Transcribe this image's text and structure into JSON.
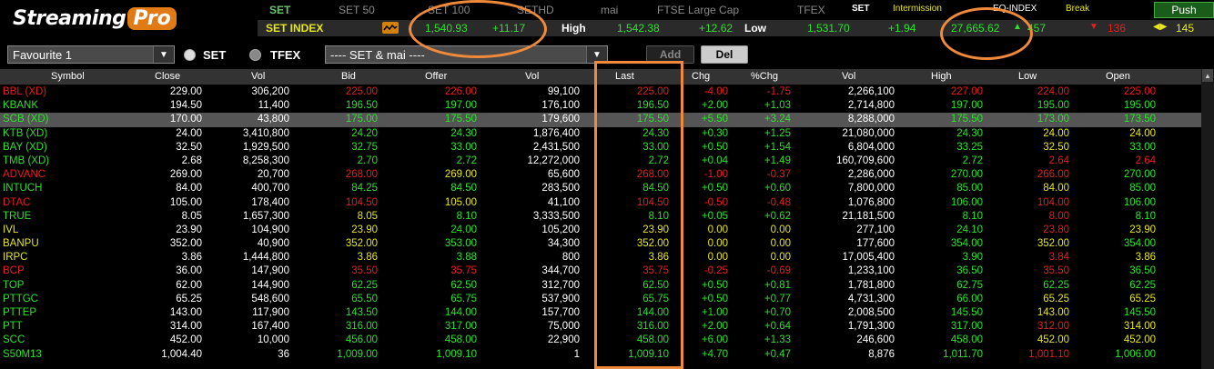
{
  "app": {
    "logo_a": "Streaming",
    "logo_b": "Pro"
  },
  "index_tabs": [
    "SET",
    "SET 50",
    "SET 100",
    "SETHD",
    "mai",
    "FTSE Large Cap",
    "TFEX"
  ],
  "market_status": {
    "set_label": "SET",
    "set_status": "Intermission",
    "eq_label": "EQ-INDEX",
    "eq_status": "Break",
    "push_label": "Push"
  },
  "index_row": {
    "name": "SET INDEX",
    "last": "1,540.93",
    "change": "+11.17",
    "high_label": "High",
    "high": "1,542.38",
    "high_chg": "+12.62",
    "low_label": "Low",
    "low": "1,531.70",
    "low_chg": "+1.94",
    "value": "27,665.62",
    "up": "457",
    "down": "136",
    "unchanged": "145"
  },
  "controls": {
    "favourite": "Favourite 1",
    "radio_set": "SET",
    "radio_tfex": "TFEX",
    "market_filter": "---- SET & mai ----",
    "add_label": "Add",
    "del_label": "Del"
  },
  "columns": [
    "Symbol",
    "Close",
    "Vol",
    "Bid",
    "Offer",
    "Vol",
    "Last",
    "Chg",
    "%Chg",
    "Vol",
    "High",
    "Low",
    "Open"
  ],
  "colors": {
    "up": "#2ee02e",
    "down": "#e61e1e",
    "same": "#e6e61a",
    "white": "#ffffff",
    "highlight": "#f08a3a"
  },
  "rows": [
    {
      "c": "down",
      "sym": "BBL (XD)",
      "close": "229.00",
      "vol1": "306,200",
      "bid": "225.00",
      "offer": "226.00",
      "vol2": "99,100",
      "last": "225.00",
      "chg": "-4.00",
      "pchg": "-1.75",
      "vol3": "2,266,100",
      "high": "227.00",
      "low": "224.00",
      "open": "225.00",
      "bc": "down",
      "oc": "down",
      "hc": "down",
      "lc": "down",
      "opc": "down"
    },
    {
      "c": "up",
      "sym": "KBANK",
      "close": "194.50",
      "vol1": "11,400",
      "bid": "196.50",
      "offer": "197.00",
      "vol2": "176,100",
      "last": "196.50",
      "chg": "+2.00",
      "pchg": "+1.03",
      "vol3": "2,714,800",
      "high": "197.00",
      "low": "195.00",
      "open": "195.00",
      "bc": "up",
      "oc": "up",
      "hc": "up",
      "lc": "up",
      "opc": "up"
    },
    {
      "c": "up",
      "sym": "SCB (XD)",
      "close": "170.00",
      "vol1": "43,800",
      "bid": "175.00",
      "offer": "175.50",
      "vol2": "179,600",
      "last": "175.50",
      "chg": "+5.50",
      "pchg": "+3.24",
      "vol3": "8,288,000",
      "high": "175.50",
      "low": "173.00",
      "open": "173.50",
      "bc": "up",
      "oc": "up",
      "hc": "up",
      "lc": "up",
      "opc": "up"
    },
    {
      "c": "up",
      "sym": "KTB (XD)",
      "close": "24.00",
      "vol1": "3,410,800",
      "bid": "24.20",
      "offer": "24.30",
      "vol2": "1,876,400",
      "last": "24.30",
      "chg": "+0.30",
      "pchg": "+1.25",
      "vol3": "21,080,000",
      "high": "24.30",
      "low": "24.00",
      "open": "24.00",
      "bc": "up",
      "oc": "up",
      "hc": "up",
      "lc": "same",
      "opc": "same"
    },
    {
      "c": "up",
      "sym": "BAY (XD)",
      "close": "32.50",
      "vol1": "1,929,500",
      "bid": "32.75",
      "offer": "33.00",
      "vol2": "2,431,500",
      "last": "33.00",
      "chg": "+0.50",
      "pchg": "+1.54",
      "vol3": "6,804,000",
      "high": "33.25",
      "low": "32.50",
      "open": "33.00",
      "bc": "up",
      "oc": "up",
      "hc": "up",
      "lc": "same",
      "opc": "up"
    },
    {
      "c": "up",
      "sym": "TMB (XD)",
      "close": "2.68",
      "vol1": "8,258,300",
      "bid": "2.70",
      "offer": "2.72",
      "vol2": "12,272,000",
      "last": "2.72",
      "chg": "+0.04",
      "pchg": "+1.49",
      "vol3": "160,709,600",
      "high": "2.72",
      "low": "2.64",
      "open": "2.64",
      "bc": "up",
      "oc": "up",
      "hc": "up",
      "lc": "down",
      "opc": "down"
    },
    {
      "c": "down",
      "sym": "ADVANC",
      "close": "269.00",
      "vol1": "20,700",
      "bid": "268.00",
      "offer": "269.00",
      "vol2": "65,600",
      "last": "268.00",
      "chg": "-1.00",
      "pchg": "-0.37",
      "vol3": "2,286,000",
      "high": "270.00",
      "low": "266.00",
      "open": "270.00",
      "bc": "down",
      "oc": "same",
      "hc": "up",
      "lc": "down",
      "opc": "up"
    },
    {
      "c": "up",
      "sym": "INTUCH",
      "close": "84.00",
      "vol1": "400,700",
      "bid": "84.25",
      "offer": "84.50",
      "vol2": "283,500",
      "last": "84.50",
      "chg": "+0.50",
      "pchg": "+0.60",
      "vol3": "7,800,000",
      "high": "85.00",
      "low": "84.00",
      "open": "85.00",
      "bc": "up",
      "oc": "up",
      "hc": "up",
      "lc": "same",
      "opc": "up"
    },
    {
      "c": "down",
      "sym": "DTAC",
      "close": "105.00",
      "vol1": "178,400",
      "bid": "104.50",
      "offer": "105.00",
      "vol2": "41,100",
      "last": "104.50",
      "chg": "-0.50",
      "pchg": "-0.48",
      "vol3": "1,076,800",
      "high": "106.00",
      "low": "104.00",
      "open": "106.00",
      "bc": "down",
      "oc": "same",
      "hc": "up",
      "lc": "down",
      "opc": "up"
    },
    {
      "c": "up",
      "sym": "TRUE",
      "close": "8.05",
      "vol1": "1,657,300",
      "bid": "8.05",
      "offer": "8.10",
      "vol2": "3,333,500",
      "last": "8.10",
      "chg": "+0.05",
      "pchg": "+0.62",
      "vol3": "21,181,500",
      "high": "8.10",
      "low": "8.00",
      "open": "8.10",
      "bc": "same",
      "oc": "up",
      "hc": "up",
      "lc": "down",
      "opc": "up"
    },
    {
      "c": "same",
      "sym": "IVL",
      "close": "23.90",
      "vol1": "104,900",
      "bid": "23.90",
      "offer": "24.00",
      "vol2": "105,200",
      "last": "23.90",
      "chg": "0.00",
      "pchg": "0.00",
      "vol3": "277,100",
      "high": "24.10",
      "low": "23.80",
      "open": "23.90",
      "bc": "same",
      "oc": "up",
      "hc": "up",
      "lc": "down",
      "opc": "same"
    },
    {
      "c": "same",
      "sym": "BANPU",
      "close": "352.00",
      "vol1": "40,900",
      "bid": "352.00",
      "offer": "353.00",
      "vol2": "34,300",
      "last": "352.00",
      "chg": "0.00",
      "pchg": "0.00",
      "vol3": "177,600",
      "high": "354.00",
      "low": "352.00",
      "open": "354.00",
      "bc": "same",
      "oc": "up",
      "hc": "up",
      "lc": "same",
      "opc": "up"
    },
    {
      "c": "same",
      "sym": "IRPC",
      "close": "3.86",
      "vol1": "1,444,800",
      "bid": "3.86",
      "offer": "3.88",
      "vol2": "800",
      "last": "3.86",
      "chg": "0.00",
      "pchg": "0.00",
      "vol3": "17,005,400",
      "high": "3.90",
      "low": "3.84",
      "open": "3.86",
      "bc": "same",
      "oc": "up",
      "hc": "up",
      "lc": "down",
      "opc": "same"
    },
    {
      "c": "down",
      "sym": "BCP",
      "close": "36.00",
      "vol1": "147,900",
      "bid": "35.50",
      "offer": "35.75",
      "vol2": "344,700",
      "last": "35.75",
      "chg": "-0.25",
      "pchg": "-0.69",
      "vol3": "1,233,100",
      "high": "36.50",
      "low": "35.50",
      "open": "36.50",
      "bc": "down",
      "oc": "down",
      "hc": "up",
      "lc": "down",
      "opc": "up"
    },
    {
      "c": "up",
      "sym": "TOP",
      "close": "62.00",
      "vol1": "144,900",
      "bid": "62.25",
      "offer": "62.50",
      "vol2": "312,700",
      "last": "62.50",
      "chg": "+0.50",
      "pchg": "+0.81",
      "vol3": "1,781,800",
      "high": "62.75",
      "low": "62.25",
      "open": "62.25",
      "bc": "up",
      "oc": "up",
      "hc": "up",
      "lc": "up",
      "opc": "up"
    },
    {
      "c": "up",
      "sym": "PTTGC",
      "close": "65.25",
      "vol1": "548,600",
      "bid": "65.50",
      "offer": "65.75",
      "vol2": "537,900",
      "last": "65.75",
      "chg": "+0.50",
      "pchg": "+0.77",
      "vol3": "4,731,300",
      "high": "66.00",
      "low": "65.25",
      "open": "65.25",
      "bc": "up",
      "oc": "up",
      "hc": "up",
      "lc": "same",
      "opc": "same"
    },
    {
      "c": "up",
      "sym": "PTTEP",
      "close": "143.00",
      "vol1": "117,900",
      "bid": "143.50",
      "offer": "144.00",
      "vol2": "157,700",
      "last": "144.00",
      "chg": "+1.00",
      "pchg": "+0.70",
      "vol3": "2,008,500",
      "high": "145.50",
      "low": "143.00",
      "open": "145.50",
      "bc": "up",
      "oc": "up",
      "hc": "up",
      "lc": "same",
      "opc": "up"
    },
    {
      "c": "up",
      "sym": "PTT",
      "close": "314.00",
      "vol1": "167,400",
      "bid": "316.00",
      "offer": "317.00",
      "vol2": "75,000",
      "last": "316.00",
      "chg": "+2.00",
      "pchg": "+0.64",
      "vol3": "1,791,300",
      "high": "317.00",
      "low": "312.00",
      "open": "314.00",
      "bc": "up",
      "oc": "up",
      "hc": "up",
      "lc": "down",
      "opc": "same"
    },
    {
      "c": "up",
      "sym": "SCC",
      "close": "452.00",
      "vol1": "10,000",
      "bid": "456.00",
      "offer": "458.00",
      "vol2": "22,900",
      "last": "458.00",
      "chg": "+6.00",
      "pchg": "+1.33",
      "vol3": "246,600",
      "high": "458.00",
      "low": "452.00",
      "open": "452.00",
      "bc": "up",
      "oc": "up",
      "hc": "up",
      "lc": "same",
      "opc": "same"
    },
    {
      "c": "up",
      "sym": "S50M13",
      "close": "1,004.40",
      "vol1": "36",
      "bid": "1,009.00",
      "offer": "1,009.10",
      "vol2": "1",
      "last": "1,009.10",
      "chg": "+4.70",
      "pchg": "+0.47",
      "vol3": "8,876",
      "high": "1,011.70",
      "low": "1,001.10",
      "open": "1,006.00",
      "bc": "up",
      "oc": "up",
      "hc": "up",
      "lc": "down",
      "opc": "up"
    }
  ]
}
